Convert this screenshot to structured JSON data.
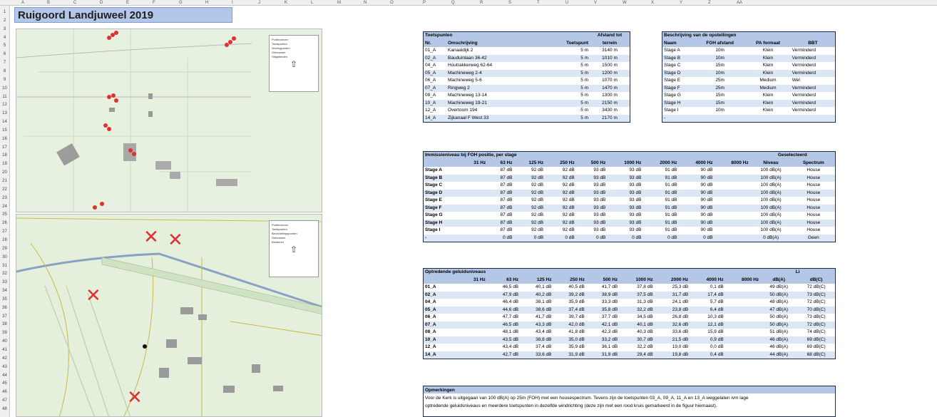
{
  "sheet": {
    "title": "Ruigoord Landjuweel 2019",
    "columns": [
      "A",
      "B",
      "C",
      "D",
      "E",
      "F",
      "G",
      "H",
      "I",
      "J",
      "K",
      "L",
      "M",
      "N",
      "O",
      "P",
      "Q",
      "R",
      "S",
      "T",
      "U",
      "V",
      "W",
      "X",
      "Y",
      "Z",
      "AA"
    ],
    "rows": [
      "1",
      "2",
      "3",
      "4",
      "5",
      "6",
      "7",
      "8",
      "9",
      "10",
      "11",
      "12",
      "13",
      "14",
      "15",
      "16",
      "17",
      "18",
      "19",
      "20",
      "21",
      "22",
      "23",
      "24",
      "25",
      "26",
      "27",
      "28",
      "29",
      "30",
      "31",
      "32",
      "33",
      "34",
      "35",
      "36",
      "37",
      "38",
      "39",
      "40",
      "41",
      "42",
      "43",
      "44",
      "45",
      "46",
      "47",
      "48"
    ]
  },
  "maps": {
    "map1_legend": [
      "Puntbronnen",
      "Toetspunten",
      "Woningpunten",
      "Gebouwen",
      "Stilgebieden"
    ],
    "map2_legend": [
      "Puntbronnen",
      "Toetspunten",
      "Beoordelingspunten",
      "Gebouwen",
      "Bestemm"
    ]
  },
  "toetspunten": {
    "title": "Toetspunten",
    "headers": [
      "Nr.",
      "Omschrijving",
      "Toetspunt",
      "Afstand tot terrein"
    ],
    "header_top": "Afstand tot",
    "header_bottom": "terrein",
    "rows": [
      [
        "01_A",
        "Kanaaldijk 2",
        "5 m",
        "3140 m"
      ],
      [
        "02_A",
        "Bauduinlaan 36-42",
        "5 m",
        "1010 m"
      ],
      [
        "04_A",
        "Houtrakkerweg 62-64",
        "5 m",
        "1500 m"
      ],
      [
        "05_A",
        "Machineweg 2-4",
        "5 m",
        "1200 m"
      ],
      [
        "06_A",
        "Machineweg 5-6",
        "5 m",
        "1070 m"
      ],
      [
        "07_A",
        "Ringweg 2",
        "5 m",
        "1470 m"
      ],
      [
        "08_A",
        "Machineweg 13-14",
        "5 m",
        "1300 m"
      ],
      [
        "10_A",
        "Machineweg 19-21",
        "5 m",
        "2150 m"
      ],
      [
        "12_A",
        "Overtoom 194",
        "5 m",
        "3430 m"
      ],
      [
        "14_A",
        "Zijkanaal F West 33",
        "5 m",
        "2170 m"
      ]
    ]
  },
  "opstellingen": {
    "title": "Beschrijving van de opstellingen",
    "headers": [
      "Naam",
      "FOH afstand",
      "PA formaat",
      "BBT"
    ],
    "rows": [
      [
        "Stage A",
        "10m",
        "Klein",
        "Verminderd"
      ],
      [
        "Stage B",
        "10m",
        "Klein",
        "Verminderd"
      ],
      [
        "Stage C",
        "15m",
        "Klein",
        "Verminderd"
      ],
      [
        "Stage D",
        "10m",
        "Klein",
        "Verminderd"
      ],
      [
        "Stage E",
        "25m",
        "Medium",
        "Wel"
      ],
      [
        "Stage F",
        "25m",
        "Medium",
        "Verminderd"
      ],
      [
        "Stage G",
        "15m",
        "Klein",
        "Verminderd"
      ],
      [
        "Stage H",
        "15m",
        "Klein",
        "Verminderd"
      ],
      [
        "Stage I",
        "10m",
        "Klein",
        "Verminderd"
      ],
      [
        "-",
        "",
        "",
        ""
      ]
    ]
  },
  "immissie": {
    "title": "Immissieniveau bij FOH positie, per stage",
    "selected_header": "Geselecteerd",
    "freqs": [
      "31 Hz",
      "63 Hz",
      "125 Hz",
      "250 Hz",
      "500 Hz",
      "1000 Hz",
      "2000 Hz",
      "4000 Hz",
      "8000 Hz"
    ],
    "sel_cols": [
      "Niveau",
      "Spectrum"
    ],
    "rows": [
      [
        "Stage A",
        "",
        "87 dB",
        "92 dB",
        "92 dB",
        "93 dB",
        "93 dB",
        "91 dB",
        "90 dB",
        "",
        "100 dB(A)",
        "House"
      ],
      [
        "Stage B",
        "",
        "87 dB",
        "92 dB",
        "92 dB",
        "93 dB",
        "93 dB",
        "91 dB",
        "90 dB",
        "",
        "100 dB(A)",
        "House"
      ],
      [
        "Stage C",
        "",
        "87 dB",
        "92 dB",
        "92 dB",
        "93 dB",
        "93 dB",
        "91 dB",
        "90 dB",
        "",
        "100 dB(A)",
        "House"
      ],
      [
        "Stage D",
        "",
        "87 dB",
        "92 dB",
        "92 dB",
        "93 dB",
        "93 dB",
        "91 dB",
        "90 dB",
        "",
        "100 dB(A)",
        "House"
      ],
      [
        "Stage E",
        "",
        "87 dB",
        "92 dB",
        "92 dB",
        "93 dB",
        "93 dB",
        "91 dB",
        "90 dB",
        "",
        "100 dB(A)",
        "House"
      ],
      [
        "Stage F",
        "",
        "87 dB",
        "92 dB",
        "92 dB",
        "93 dB",
        "93 dB",
        "91 dB",
        "90 dB",
        "",
        "100 dB(A)",
        "House"
      ],
      [
        "Stage G",
        "",
        "87 dB",
        "92 dB",
        "92 dB",
        "93 dB",
        "93 dB",
        "91 dB",
        "90 dB",
        "",
        "100 dB(A)",
        "House"
      ],
      [
        "Stage H",
        "",
        "87 dB",
        "92 dB",
        "92 dB",
        "93 dB",
        "93 dB",
        "91 dB",
        "90 dB",
        "",
        "100 dB(A)",
        "House"
      ],
      [
        "Stage I",
        "",
        "87 dB",
        "92 dB",
        "92 dB",
        "93 dB",
        "93 dB",
        "91 dB",
        "90 dB",
        "",
        "100 dB(A)",
        "House"
      ],
      [
        "-",
        "",
        "0 dB",
        "0 dB",
        "0 dB",
        "0 dB",
        "0 dB",
        "0 dB",
        "0 dB",
        "",
        "0 dB(A)",
        "Geen"
      ]
    ]
  },
  "geluid": {
    "title": "Optredende geluidsniveaus",
    "li_header": "Li",
    "freqs": [
      "31 Hz",
      "63 Hz",
      "125 Hz",
      "250 Hz",
      "500 Hz",
      "1000 Hz",
      "2000 Hz",
      "4000 Hz",
      "8000 Hz"
    ],
    "li_cols": [
      "dB(A)",
      "dB(C)"
    ],
    "rows": [
      [
        "01_A",
        "",
        "46,5 dB",
        "40,1 dB",
        "40,5 dB",
        "41,7 dB",
        "37,8 dB",
        "25,3 dB",
        "0,1 dB",
        "",
        "49 dB(A)",
        "72 dB(C)"
      ],
      [
        "02_A",
        "",
        "47,9 dB",
        "40,2 dB",
        "39,2 dB",
        "38,9 dB",
        "37,5 dB",
        "31,7 dB",
        "17,4 dB",
        "",
        "50 dB(A)",
        "73 dB(C)"
      ],
      [
        "04_A",
        "",
        "46,4 dB",
        "38,1 dB",
        "35,9 dB",
        "33,3 dB",
        "31,3 dB",
        "24,1 dB",
        "5,7 dB",
        "",
        "48 dB(A)",
        "72 dB(C)"
      ],
      [
        "05_A",
        "",
        "44,6 dB",
        "38,6 dB",
        "37,4 dB",
        "35,8 dB",
        "32,2 dB",
        "23,8 dB",
        "6,4 dB",
        "",
        "47 dB(A)",
        "70 dB(C)"
      ],
      [
        "06_A",
        "",
        "47,7 dB",
        "41,7 dB",
        "39,7 dB",
        "37,7 dB",
        "34,5 dB",
        "26,8 dB",
        "10,3 dB",
        "",
        "50 dB(A)",
        "73 dB(C)"
      ],
      [
        "07_A",
        "",
        "46,5 dB",
        "43,3 dB",
        "42,0 dB",
        "42,1 dB",
        "40,1 dB",
        "32,6 dB",
        "12,1 dB",
        "",
        "50 dB(A)",
        "72 dB(C)"
      ],
      [
        "08_A",
        "",
        "48,1 dB",
        "43,4 dB",
        "41,8 dB",
        "42,3 dB",
        "40,3 dB",
        "33,6 dB",
        "15,9 dB",
        "",
        "51 dB(A)",
        "74 dB(C)"
      ],
      [
        "10_A",
        "",
        "43,5 dB",
        "38,8 dB",
        "35,0 dB",
        "33,2 dB",
        "30,7 dB",
        "21,5 dB",
        "0,9 dB",
        "",
        "46 dB(A)",
        "69 dB(C)"
      ],
      [
        "12_A",
        "",
        "43,4 dB",
        "37,4 dB",
        "35,9 dB",
        "36,1 dB",
        "32,2 dB",
        "19,0 dB",
        "0,0 dB",
        "",
        "46 dB(A)",
        "69 dB(C)"
      ],
      [
        "14_A",
        "",
        "42,7 dB",
        "33,6 dB",
        "31,9 dB",
        "31,9 dB",
        "29,4 dB",
        "19,8 dB",
        "0,4 dB",
        "",
        "44 dB(A)",
        "68 dB(C)"
      ]
    ]
  },
  "opmerkingen": {
    "title": "Opmerkingen",
    "line1": "Voor de Kerk is uitgegaan van 100 dB(A) op 25m (FOH) met een housespectrum. Tevens zijn de toetspunten 03_A, 09_A, 11_A en 13_A weggelaten ivm lage",
    "line2": "optredende geluidsniveaus en meerdere toetspunten in dezelfde windrichting (deze zijn met een rood kruis gemarkeerd in de figuur hiernaast)."
  },
  "colors": {
    "header_blue": "#b4c7e7",
    "alt_row": "#dde6f4",
    "cross_red": "#e03030"
  }
}
